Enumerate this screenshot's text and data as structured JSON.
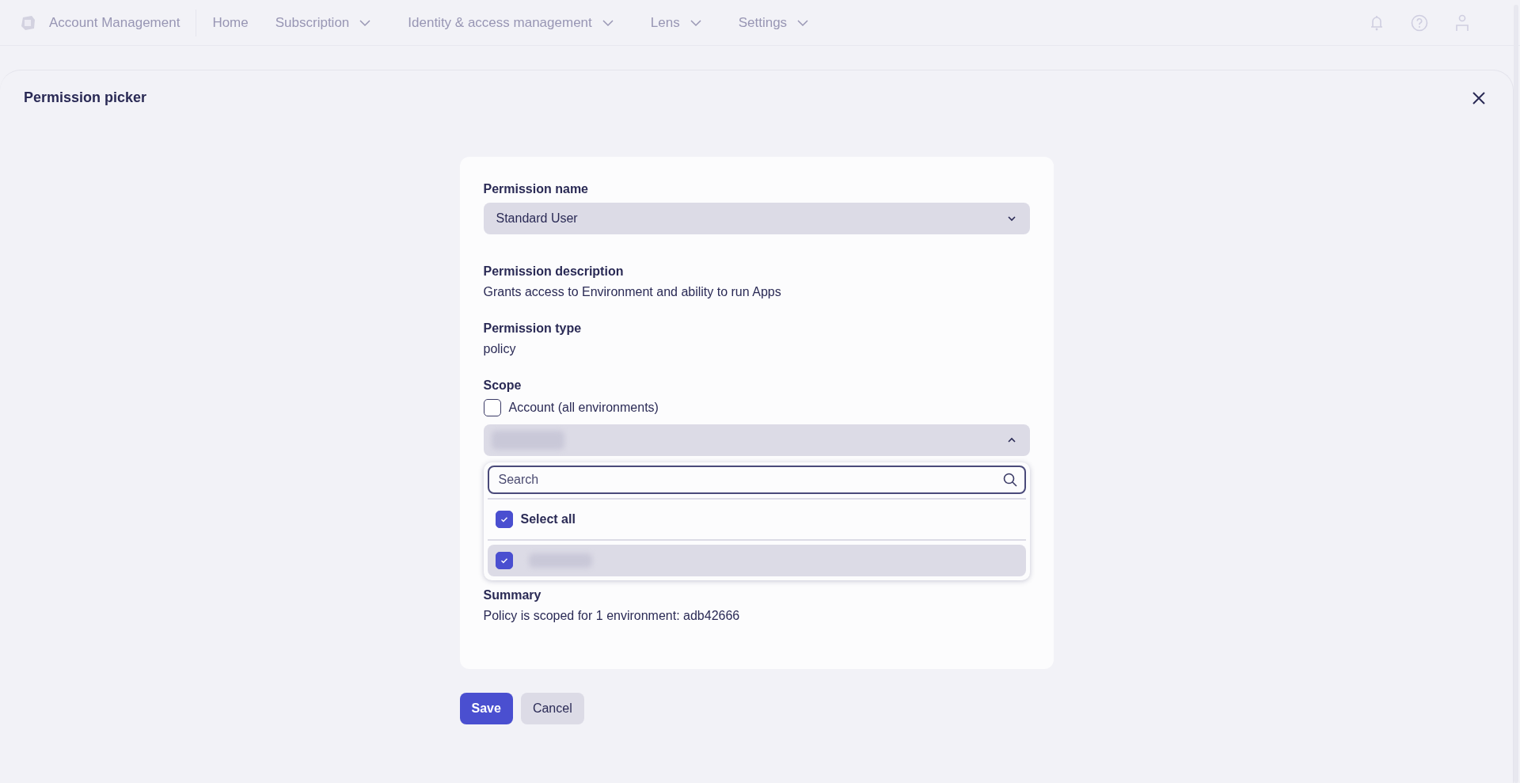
{
  "top_nav": {
    "app_title": "Account Management",
    "items": [
      {
        "label": "Home",
        "has_menu": false
      },
      {
        "label": "Subscription",
        "has_menu": true
      },
      {
        "label": "Identity & access management",
        "has_menu": true
      },
      {
        "label": "Lens",
        "has_menu": true
      },
      {
        "label": "Settings",
        "has_menu": true
      }
    ]
  },
  "dialog": {
    "title": "Permission picker"
  },
  "form": {
    "permission_name": {
      "label": "Permission name",
      "value": "Standard User",
      "expanded": false
    },
    "description": {
      "label": "Permission description",
      "text": "Grants access to Environment and ability to run Apps"
    },
    "permission_type": {
      "label": "Permission type",
      "text": "policy"
    },
    "scope": {
      "label": "Scope",
      "account_checkbox": {
        "label": "Account (all environments)",
        "checked": false
      },
      "environment_select": {
        "expanded": true
      },
      "dropdown": {
        "search": {
          "placeholder": "Search"
        },
        "select_all": {
          "label": "Select all",
          "checked": true
        },
        "options": [
          {
            "checked": true,
            "selected": true
          }
        ]
      }
    },
    "summary": {
      "label": "Summary",
      "text": "Policy is scoped for 1 environment: adb42666"
    }
  },
  "buttons": [
    {
      "label": "Save",
      "kind": "primary"
    },
    {
      "label": "Cancel",
      "kind": "secondary"
    }
  ]
}
